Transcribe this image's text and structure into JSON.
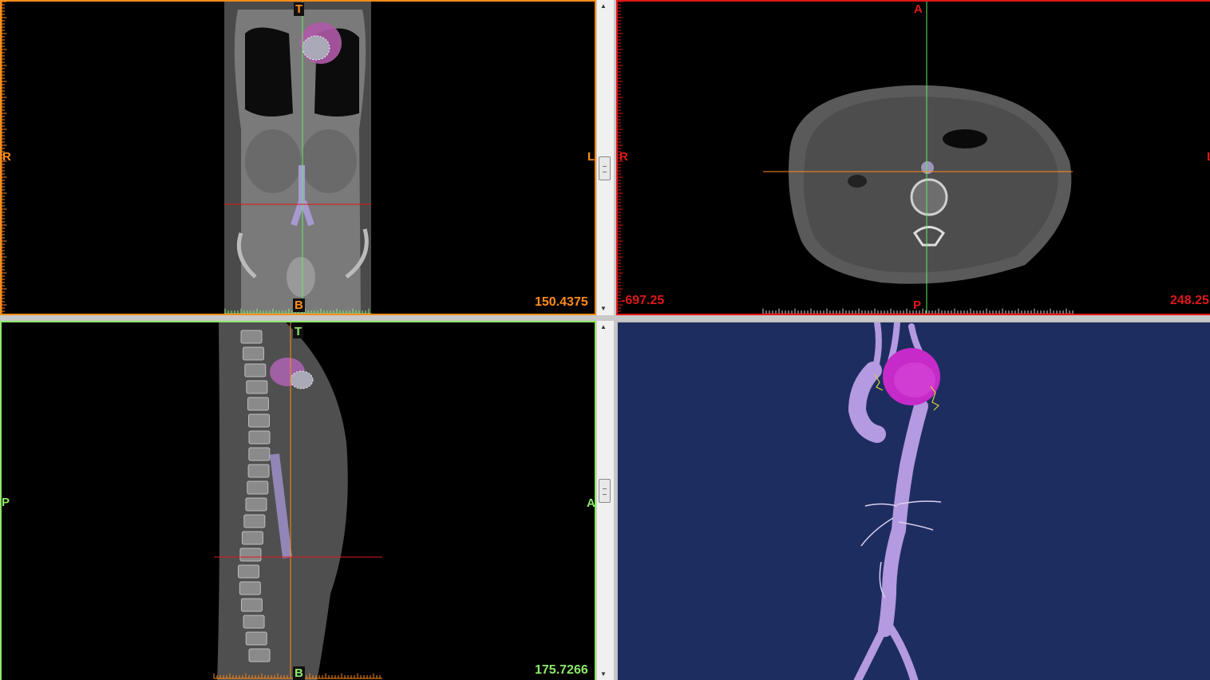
{
  "colors": {
    "coronal": "#ff8c1a",
    "axial": "#e01818",
    "sagittal": "#8ee86a",
    "volume_bg": "#1e2d60",
    "vessel": "#b49ae0",
    "aneurysm": "#d22ad2"
  },
  "coronal": {
    "label_top": "T",
    "label_bottom": "B",
    "label_left": "R",
    "label_right": "L",
    "value": "150.4375"
  },
  "axial": {
    "label_top": "A",
    "label_bottom": "P",
    "label_left": "R",
    "label_right": "L",
    "value_left": "-697.25",
    "value_right": "248.25"
  },
  "sagittal": {
    "label_top": "T",
    "label_bottom": "B",
    "label_left": "P",
    "label_right": "A",
    "value": "175.7266"
  },
  "volume": {
    "icons": [
      "aorta-3d-model",
      "aneurysm-sac"
    ]
  }
}
